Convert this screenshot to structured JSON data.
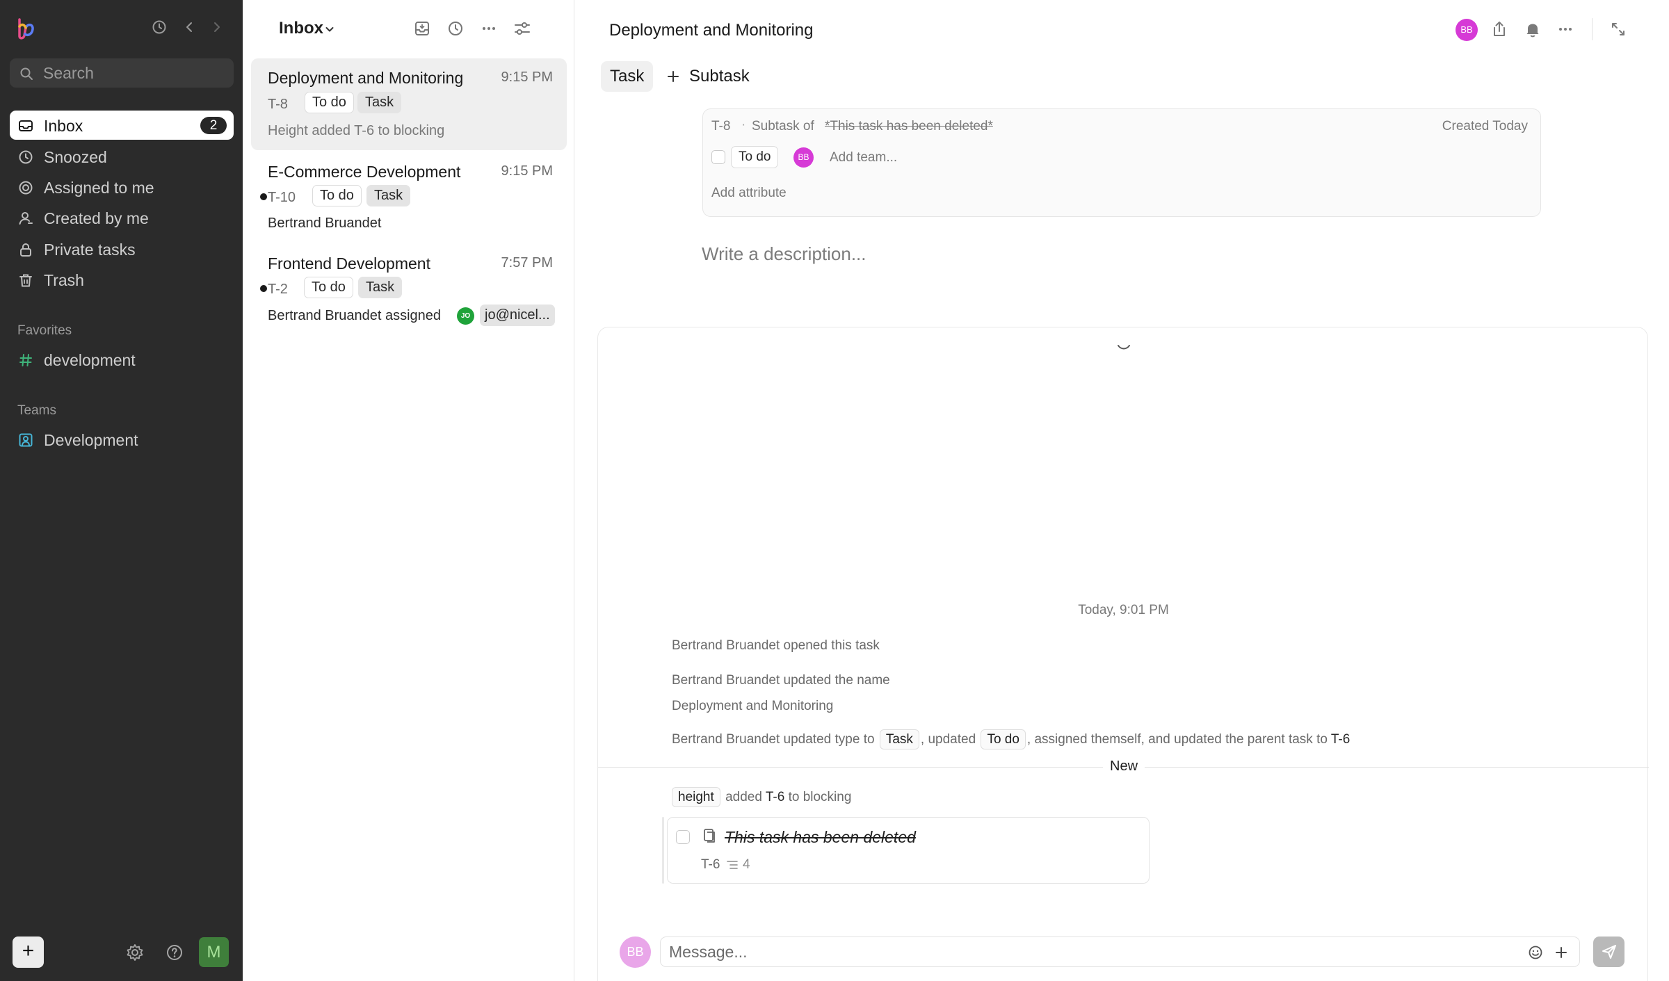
{
  "sidebar": {
    "search_placeholder": "Search",
    "items": [
      {
        "label": "Inbox",
        "badge": "2",
        "icon": "inbox-icon",
        "active": true
      },
      {
        "label": "Snoozed",
        "icon": "clock-icon"
      },
      {
        "label": "Assigned to me",
        "icon": "target-icon"
      },
      {
        "label": "Created by me",
        "icon": "user-icon"
      },
      {
        "label": "Private tasks",
        "icon": "lock-icon"
      },
      {
        "label": "Trash",
        "icon": "trash-icon"
      }
    ],
    "favorites_title": "Favorites",
    "favorites": [
      {
        "label": "development",
        "icon": "hash-icon"
      }
    ],
    "teams_title": "Teams",
    "teams": [
      {
        "label": "Development",
        "icon": "team-icon"
      }
    ],
    "user_initial": "M"
  },
  "inbox": {
    "title": "Inbox",
    "items": [
      {
        "title": "Deployment and Monitoring",
        "time": "9:15 PM",
        "key": "T-8",
        "status": "To do",
        "type": "Task",
        "subtitle": "Height added T-6 to blocking",
        "unread": false,
        "selected": true
      },
      {
        "title": "E-Commerce Development",
        "time": "9:15 PM",
        "key": "T-10",
        "status": "To do",
        "type": "Task",
        "subtitle": "Bertrand Bruandet",
        "unread": true
      },
      {
        "title": "Frontend Development",
        "time": "7:57 PM",
        "key": "T-2",
        "status": "To do",
        "type": "Task",
        "subtitle": "Bertrand Bruandet assigned",
        "assignee_initials": "JO",
        "assignee_chip": "jo@nicel...",
        "unread": true
      }
    ]
  },
  "task": {
    "title": "Deployment and Monitoring",
    "assignee_initials": "BB",
    "tabs": [
      {
        "label": "Task"
      },
      {
        "label": "Subtask"
      }
    ],
    "key": "T-8",
    "subtask_of_label": "Subtask of",
    "parent_name": "*This task has been deleted*",
    "created": "Created Today",
    "status": "To do",
    "add_team_placeholder": "Add team...",
    "add_attribute": "Add attribute",
    "description_placeholder": "Write a description..."
  },
  "activity": {
    "date": "Today, 9:01 PM",
    "entries": [
      {
        "text": "Bertrand Bruandet opened this task"
      },
      {
        "text": "Bertrand Bruandet updated the name"
      },
      {
        "text": "Deployment and Monitoring"
      }
    ],
    "update_line": {
      "prefix": "Bertrand Bruandet updated type to",
      "type_chip": "Task",
      "mid1": ", updated",
      "status_chip": "To do",
      "mid2": ", assigned themself, and updated the parent task to",
      "parent": "T-6"
    },
    "new_label": "New",
    "blocking_line": {
      "actor_chip": "height",
      "verb": "added",
      "key": "T-6",
      "suffix": "to blocking"
    },
    "linked_task": {
      "title": "This task has been deleted",
      "key": "T-6",
      "subtask_count": "4"
    }
  },
  "composer": {
    "placeholder": "Message...",
    "avatar_initials": "BB"
  },
  "colors": {
    "sidebar_bg": "#2b2b2b",
    "avatar_bb": "#d63ad6",
    "avatar_jo": "#1fa33a",
    "avatar_m": "#3f7f3b"
  }
}
